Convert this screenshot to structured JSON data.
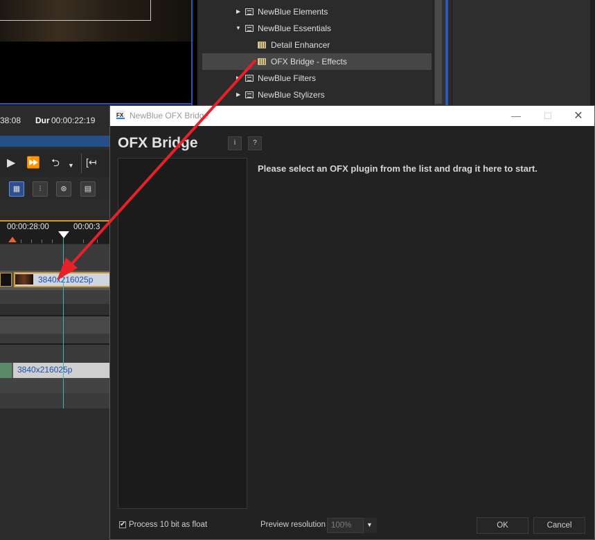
{
  "preview": {
    "timecode_left": "38:08",
    "duration_label": "Dur",
    "duration_value": "00:00:22:19"
  },
  "transport": {
    "play_icon": "play-icon",
    "fast_forward_icon": "fast-forward-icon",
    "loop_icon": "loop-icon",
    "trim_icon": "trim-icon"
  },
  "timeline": {
    "ruler_time_1": "00:00:28:00",
    "ruler_time_2": "00:00:3",
    "clips": [
      {
        "label": "3840x216025p"
      },
      {
        "label": "3840x216025p"
      }
    ]
  },
  "effects_tree": {
    "items": [
      {
        "label": "NewBlue Elements"
      },
      {
        "label": "NewBlue Essentials"
      },
      {
        "label": "Detail Enhancer"
      },
      {
        "label": "OFX Bridge - Effects"
      },
      {
        "label": "NewBlue Filters"
      },
      {
        "label": "NewBlue Stylizers"
      }
    ]
  },
  "dialog": {
    "window_title": "NewBlue OFX Bridge",
    "minimize_glyph": "—",
    "maximize_glyph": "☐",
    "close_glyph": "✕",
    "heading": "OFX Bridge",
    "info_label": "i",
    "help_label": "?",
    "instructions": "Please select an OFX plugin from the list and drag it here to start.",
    "process_float_label": "Process 10 bit as float",
    "process_float_checked": true,
    "checkmark": "✔",
    "preview_resolution_label": "Preview resolution",
    "preview_resolution_value": "100%",
    "ok_label": "OK",
    "cancel_label": "Cancel"
  },
  "colors": {
    "accent_blue": "#2a58b8",
    "playhead": "#3fb6b6",
    "clip_border": "#d19a2e",
    "annotation_arrow": "#e8202a"
  }
}
